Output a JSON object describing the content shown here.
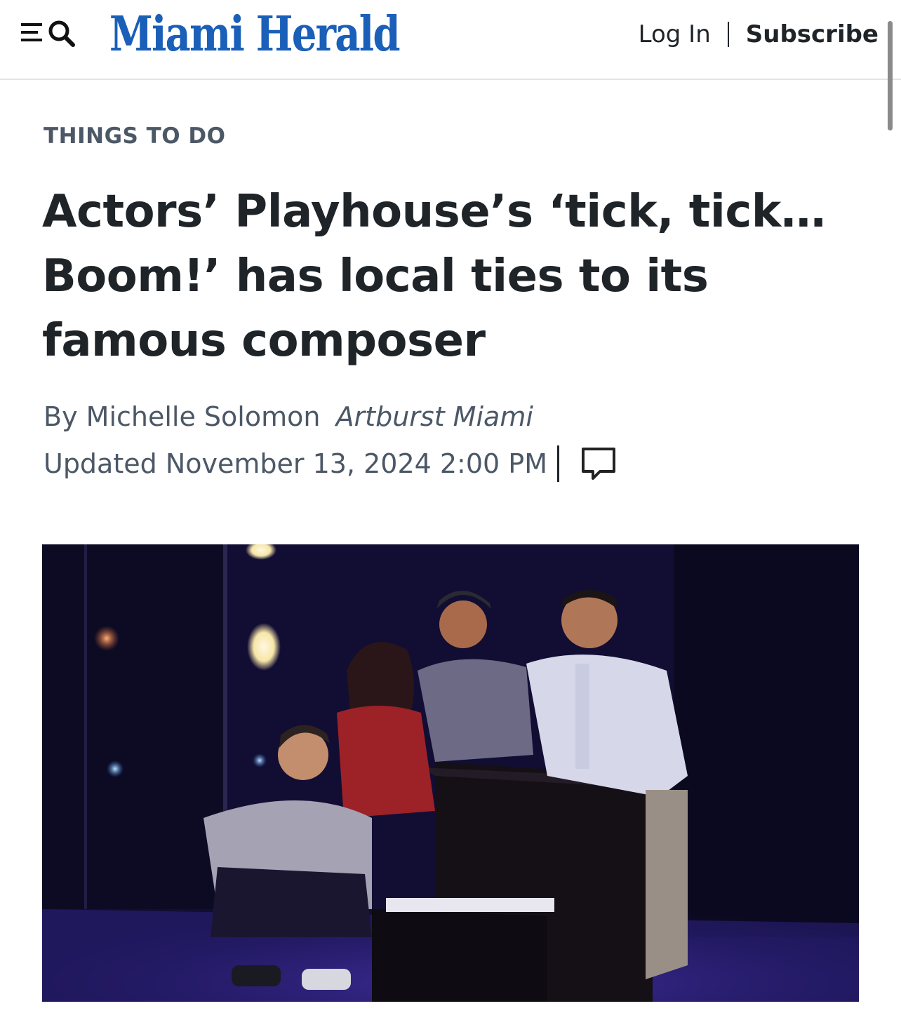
{
  "header": {
    "logo_text": "Miami Herald",
    "login_label": "Log In",
    "subscribe_label": "Subscribe",
    "menu_icon": "menu-icon",
    "search_icon": "search-icon",
    "brand_color": "#1a5fb8"
  },
  "article": {
    "section": "THINGS TO DO",
    "headline": "Actors’ Playhouse’s ‘tick, tick… Boom!’ has local ties to its famous composer",
    "byline_prefix": "By",
    "author": "Michelle Solomon",
    "source": "Artburst Miami",
    "updated": "Updated November 13, 2024 2:00 PM",
    "comment_icon": "comment-icon"
  }
}
